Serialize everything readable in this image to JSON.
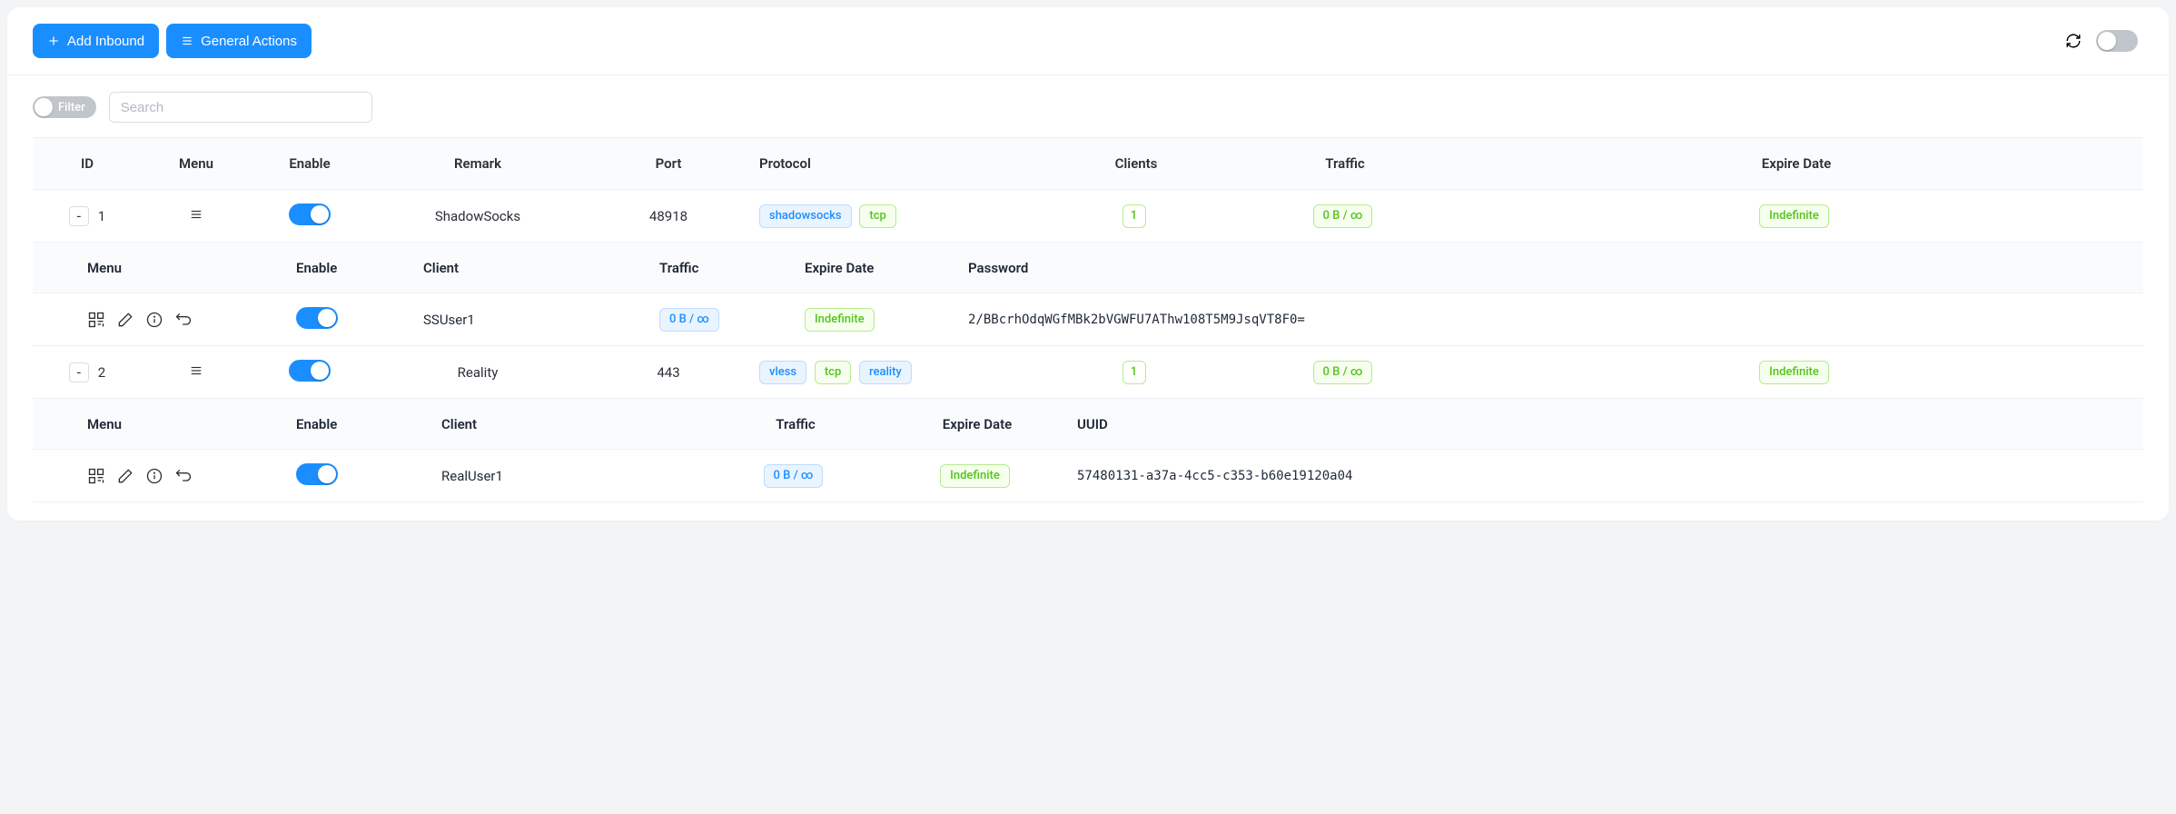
{
  "toolbar": {
    "add_label": "Add Inbound",
    "actions_label": "General Actions",
    "filter_label": "Filter",
    "search_placeholder": "Search"
  },
  "columns": {
    "id": "ID",
    "menu": "Menu",
    "enable": "Enable",
    "remark": "Remark",
    "port": "Port",
    "protocol": "Protocol",
    "clients": "Clients",
    "traffic": "Traffic",
    "expire": "Expire Date"
  },
  "sub_columns": {
    "menu": "Menu",
    "enable": "Enable",
    "client": "Client",
    "traffic": "Traffic",
    "expire": "Expire Date",
    "password": "Password",
    "uuid": "UUID"
  },
  "badges": {
    "shadowsocks": "shadowsocks",
    "tcp": "tcp",
    "vless": "vless",
    "reality": "reality",
    "traffic": "0 B / ∞",
    "expire": "Indefinite"
  },
  "rows": [
    {
      "id": "1",
      "remark": "ShadowSocks",
      "port": "48918",
      "clients": "1",
      "client_name": "SSUser1",
      "secret": "2/BBcrhOdqWGfMBk2bVGWFU7AThw108T5M9JsqVT8F0="
    },
    {
      "id": "2",
      "remark": "Reality",
      "port": "443",
      "clients": "1",
      "client_name": "RealUser1",
      "secret": "57480131-a37a-4cc5-c353-b60e19120a04"
    }
  ]
}
